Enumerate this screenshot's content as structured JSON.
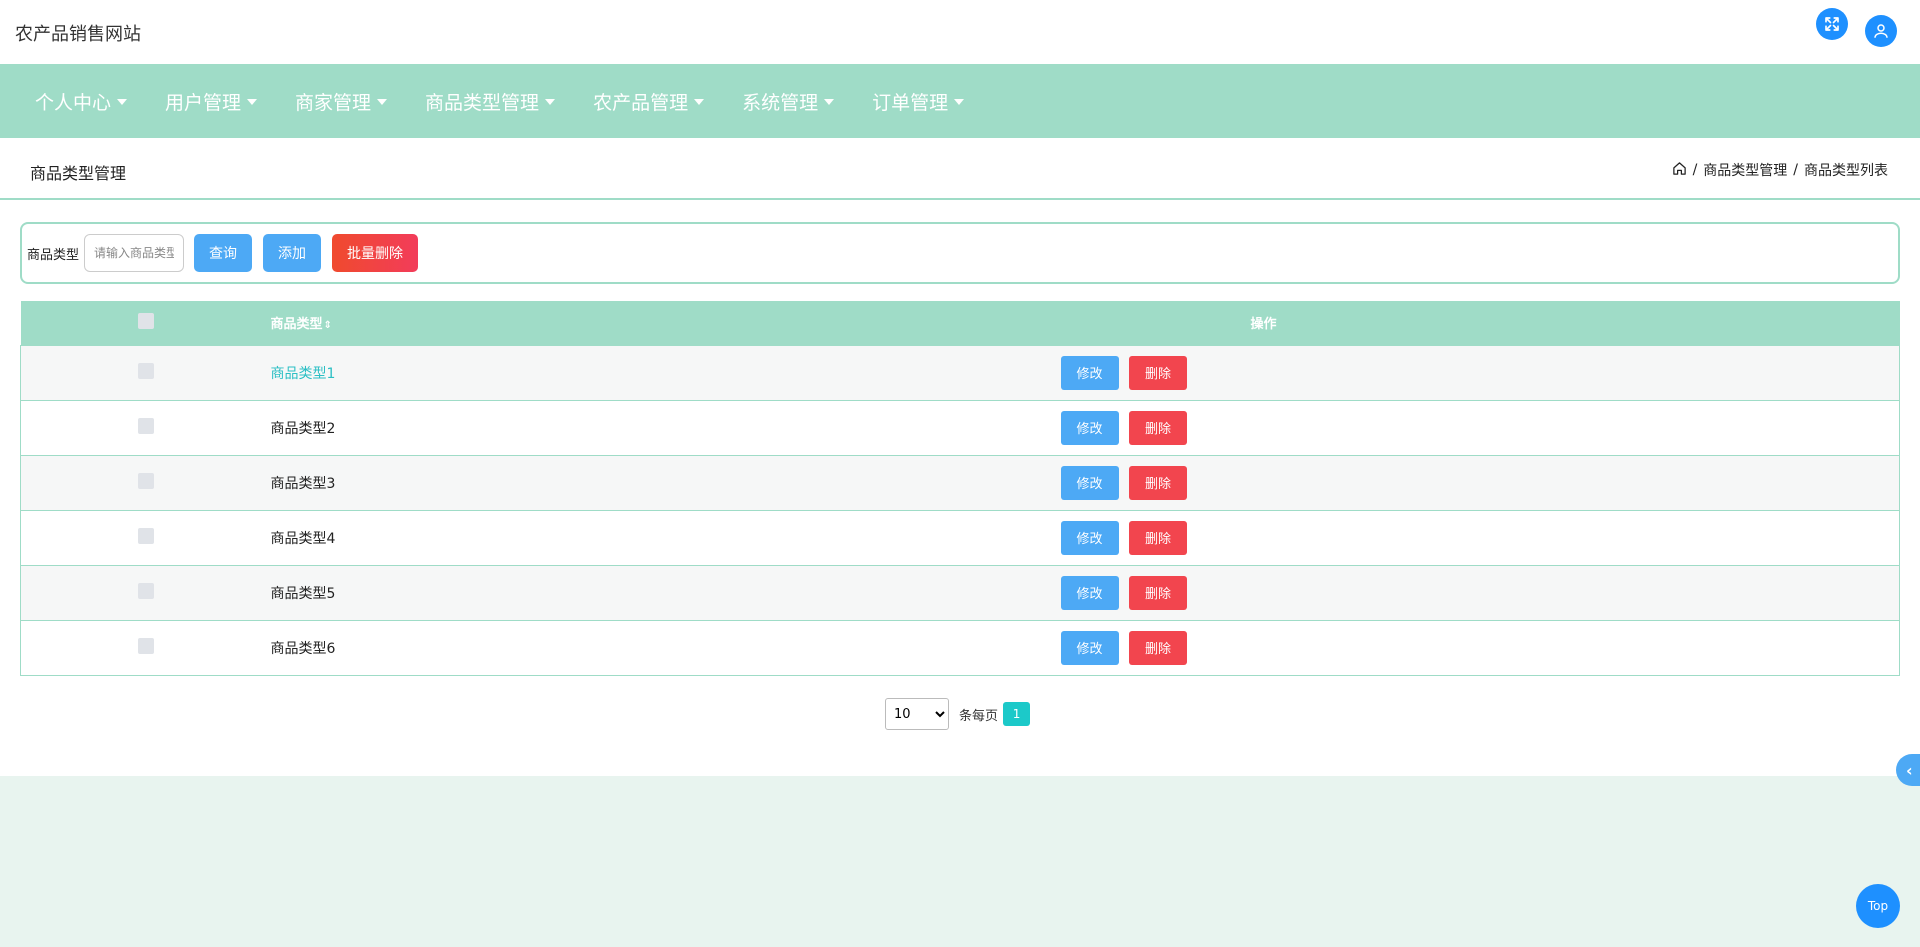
{
  "header": {
    "site_title": "农产品销售网站"
  },
  "nav": {
    "items": [
      {
        "label": "个人中心"
      },
      {
        "label": "用户管理"
      },
      {
        "label": "商家管理"
      },
      {
        "label": "商品类型管理"
      },
      {
        "label": "农产品管理"
      },
      {
        "label": "系统管理"
      },
      {
        "label": "订单管理"
      }
    ]
  },
  "page": {
    "title": "商品类型管理",
    "breadcrumb": [
      "商品类型管理",
      "商品类型列表"
    ]
  },
  "search": {
    "label": "商品类型",
    "placeholder": "请输入商品类型",
    "query_label": "查询",
    "add_label": "添加",
    "batch_delete_label": "批量删除"
  },
  "table": {
    "columns": [
      "商品类型",
      "操作"
    ],
    "rows": [
      {
        "name": "商品类型1"
      },
      {
        "name": "商品类型2"
      },
      {
        "name": "商品类型3"
      },
      {
        "name": "商品类型4"
      },
      {
        "name": "商品类型5"
      },
      {
        "name": "商品类型6"
      }
    ],
    "edit_label": "修改",
    "delete_label": "删除"
  },
  "pagination": {
    "page_size": "10",
    "page_size_options": [
      "10"
    ],
    "per_page_label": "条每页",
    "current_page": "1"
  },
  "floating": {
    "side_tab_glyph": "‹",
    "top_label": "Top"
  },
  "colors": {
    "accent": "#9fdcc7",
    "primary": "#4da9f5",
    "danger": "#f2454e",
    "link": "#2bbfc4"
  }
}
